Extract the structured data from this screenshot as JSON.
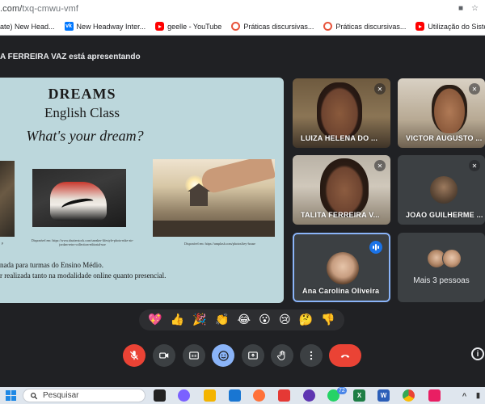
{
  "browser": {
    "url_visible": ".com/",
    "url_rest": "txq-cmwu-vmf",
    "bookmarks": [
      {
        "label": "ate) New Head...",
        "icon": "generic-icon"
      },
      {
        "label": "New Headway Inter...",
        "icon": "vk-icon"
      },
      {
        "label": "geelle - YouTube",
        "icon": "youtube-icon"
      },
      {
        "label": "Práticas discursivas...",
        "icon": "passei-direto-icon"
      },
      {
        "label": "Práticas discursivas...",
        "icon": "passei-direto-icon"
      },
      {
        "label": "Utilização do Siste...",
        "icon": "youtube-icon"
      }
    ]
  },
  "meet": {
    "presenter_text": "A FERREIRA VAZ está apresentando",
    "slide": {
      "title": "DREAMS",
      "subtitle": "English Class",
      "question": "What's your dream?",
      "captions": [
        "p",
        "Disponível em: https://www.shutterstock.com/sneaker-lifestyle-photo-nike-air-jordan-retro-collection-editorial-use",
        "Disponível em: https://unsplash.com/photos/key-house"
      ],
      "text_line1": "nada para turmas do Ensino Médio.",
      "text_line2": "r realizada tanto na modalidade online quanto presencial."
    },
    "participants": [
      {
        "name": "LUIZA HELENA DO ...",
        "muted": true
      },
      {
        "name": "VICTOR AUGUSTO ...",
        "muted": true
      },
      {
        "name": "TALITA FERREIRA V...",
        "muted": true
      },
      {
        "name": "JOAO GUILHERME ...",
        "muted": true
      },
      {
        "name": "Ana Carolina Oliveira",
        "speaking": true
      },
      {
        "name": "Mais 3 pessoas"
      }
    ],
    "reactions": [
      "💖",
      "👍",
      "🎉",
      "👏",
      "😂",
      "😮",
      "😢",
      "🤔",
      "👎"
    ],
    "controls": [
      {
        "name": "mic-off",
        "state": "off",
        "color": "#ea4335"
      },
      {
        "name": "camera",
        "state": "on",
        "color": "#3c4043"
      },
      {
        "name": "captions",
        "state": "on",
        "color": "#3c4043"
      },
      {
        "name": "reactions",
        "state": "active",
        "color": "#8ab4f8"
      },
      {
        "name": "present",
        "state": "on",
        "color": "#3c4043"
      },
      {
        "name": "raise-hand",
        "state": "on",
        "color": "#3c4043"
      },
      {
        "name": "more-options",
        "state": "on",
        "color": "#3c4043"
      },
      {
        "name": "leave-call",
        "state": "on",
        "color": "#ea4335"
      }
    ]
  },
  "taskbar": {
    "search_placeholder": "Pesquisar",
    "whatsapp_badge": "72"
  }
}
